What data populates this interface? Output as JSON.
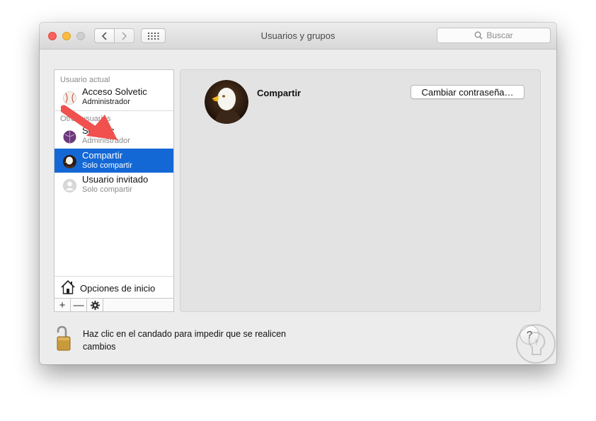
{
  "window": {
    "title": "Usuarios y grupos"
  },
  "search": {
    "placeholder": "Buscar"
  },
  "sidebar": {
    "current_user_header": "Usuario actual",
    "other_users_header": "Otros usuarios",
    "current_user": {
      "name": "Acceso Solvetic",
      "role": "Administrador",
      "avatar": "baseball-icon"
    },
    "other_users": [
      {
        "name": "Solvetic",
        "role": "Administrador",
        "avatar": "purple-ball-icon",
        "selected": false
      },
      {
        "name": "Compartir",
        "role": "Solo compartir",
        "avatar": "eagle-icon",
        "selected": true
      },
      {
        "name": "Usuario invitado",
        "role": "Solo compartir",
        "avatar": "generic-user-icon",
        "selected": false
      }
    ],
    "login_options": "Opciones de inicio",
    "add_symbol": "+",
    "remove_symbol": "—"
  },
  "main": {
    "user_name": "Compartir",
    "change_password_button": "Cambiar contraseña…"
  },
  "footer": {
    "lock_text": "Haz clic en el candado para impedir que se realicen cambios",
    "help_symbol": "?"
  },
  "colors": {
    "selection": "#1468d6",
    "annotation_arrow": "#f0504e",
    "close": "#fc605c",
    "minimize": "#fdbc40"
  }
}
